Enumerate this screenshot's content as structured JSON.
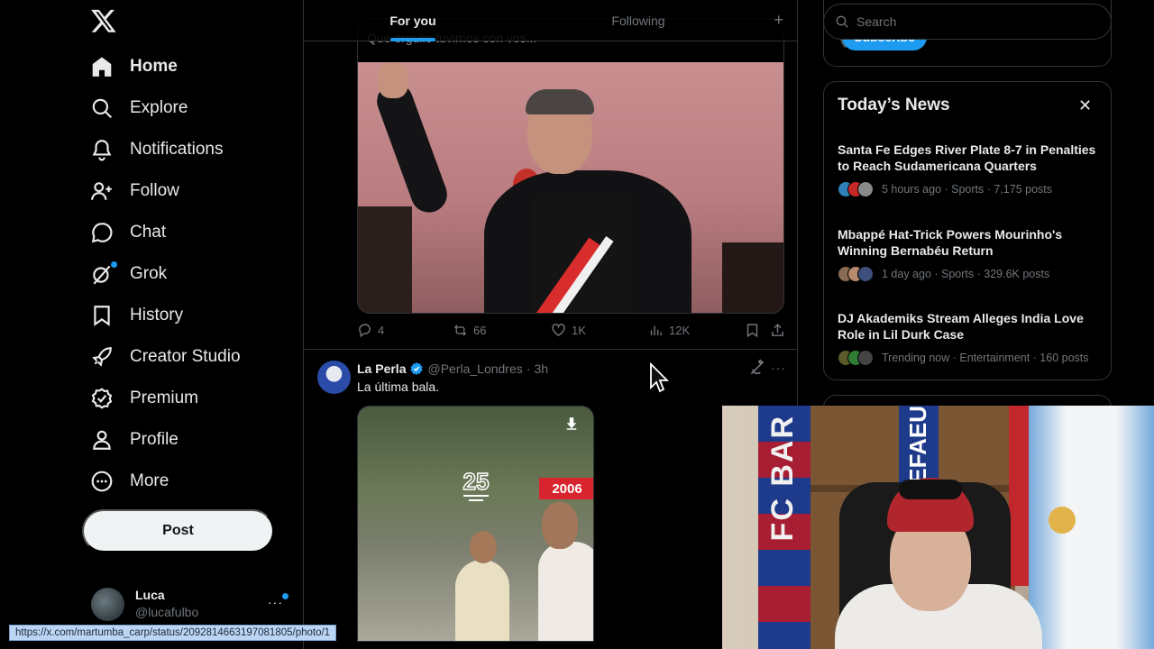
{
  "sidebar": {
    "logo": "x-logo",
    "nav": [
      {
        "label": "Home",
        "icon": "home-icon",
        "active": true
      },
      {
        "label": "Explore",
        "icon": "search-icon"
      },
      {
        "label": "Notifications",
        "icon": "bell-icon"
      },
      {
        "label": "Follow",
        "icon": "person-add-icon"
      },
      {
        "label": "Chat",
        "icon": "chat-icon"
      },
      {
        "label": "Grok",
        "icon": "grok-icon"
      },
      {
        "label": "History",
        "icon": "bookmark-icon"
      },
      {
        "label": "Creator Studio",
        "icon": "rocket-icon"
      },
      {
        "label": "Premium",
        "icon": "verified-badge-icon"
      },
      {
        "label": "Profile",
        "icon": "person-icon"
      },
      {
        "label": "More",
        "icon": "more-circle-icon"
      }
    ],
    "post_button": "Post",
    "account": {
      "name": "Luca",
      "handle": "@lucafulbo",
      "more": "···"
    }
  },
  "main": {
    "tabs": [
      {
        "label": "For you",
        "active": true
      },
      {
        "label": "Following",
        "active": false
      }
    ],
    "tab_add": "+",
    "tweet1": {
      "quote_text": "Qué orgullo tuvimos con vos...",
      "actions": {
        "replies": "4",
        "reposts": "66",
        "likes": "1K",
        "views": "12K"
      }
    },
    "tweet2": {
      "name": "La Perla",
      "handle": "@Perla_Londres",
      "separator": "·",
      "time": "3h",
      "text": "La última bala.",
      "more": "···",
      "video": {
        "year_badge": "2006"
      }
    }
  },
  "right": {
    "search_placeholder": "Search",
    "subscribe_label": "Subscribe",
    "news": {
      "title": "Today’s News",
      "close": "✕",
      "items": [
        {
          "headline": "Santa Fe Edges River Plate 8-7 in Penalties to Reach Sudamericana Quarters",
          "meta": "5 hours ago · Sports · 7,175 posts"
        },
        {
          "headline": "Mbappé Hat-Trick Powers Mourinho's Winning Bernabéu Return",
          "meta": "1 day ago · Sports · 329.6K posts"
        },
        {
          "headline": "DJ Akademiks Stream Alleges India Love Role in Lil Durk Case",
          "meta": "Trending now · Entertainment · 160 posts"
        }
      ]
    }
  },
  "webcam": {
    "scarf_text": "FC BAR",
    "scarf2_text": "EFAEU"
  },
  "status_url": "https://x.com/martumba_carp/status/2092814663197081805/photo/1",
  "colors": {
    "accent": "#1d9bf0",
    "background": "#000000",
    "text": "#e7e9ea",
    "muted": "#71767b",
    "border": "#2f3336"
  }
}
